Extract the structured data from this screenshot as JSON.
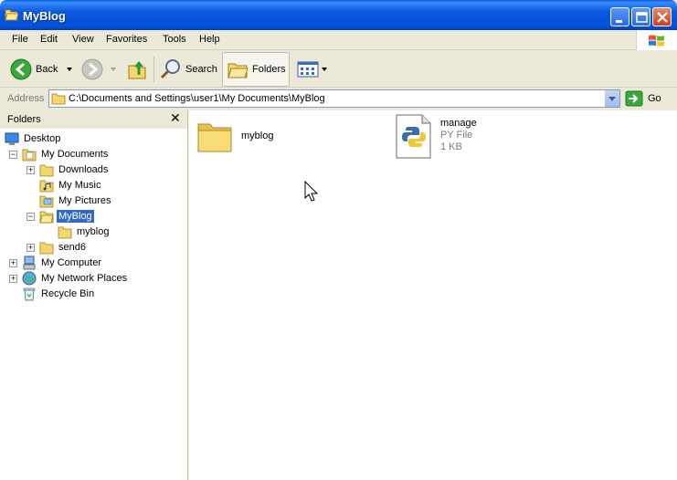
{
  "window": {
    "title": "MyBlog",
    "title_icon": "folder-open-icon"
  },
  "menu": {
    "items": [
      "File",
      "Edit",
      "View",
      "Favorites",
      "Tools",
      "Help"
    ]
  },
  "toolbar": {
    "back_label": "Back",
    "search_label": "Search",
    "folders_label": "Folders"
  },
  "address": {
    "label": "Address",
    "path": "C:\\Documents and Settings\\user1\\My Documents\\MyBlog",
    "go_label": "Go"
  },
  "folders_pane": {
    "title": "Folders",
    "tree": [
      {
        "label": "Desktop",
        "icon": "desktop-icon"
      },
      {
        "label": "My Documents",
        "icon": "my-documents-icon",
        "expanded": true
      },
      {
        "label": "Downloads",
        "icon": "folder-icon"
      },
      {
        "label": "My Music",
        "icon": "my-music-icon"
      },
      {
        "label": "My Pictures",
        "icon": "my-pictures-icon"
      },
      {
        "label": "MyBlog",
        "icon": "folder-open-icon",
        "selected": true,
        "expanded": true
      },
      {
        "label": "myblog",
        "icon": "folder-icon"
      },
      {
        "label": "send6",
        "icon": "folder-icon"
      },
      {
        "label": "My Computer",
        "icon": "my-computer-icon"
      },
      {
        "label": "My Network Places",
        "icon": "network-places-icon"
      },
      {
        "label": "Recycle Bin",
        "icon": "recycle-bin-icon"
      }
    ]
  },
  "files": [
    {
      "name": "myblog",
      "icon": "folder-icon"
    },
    {
      "name": "manage",
      "type": "PY File",
      "size": "1 KB",
      "icon": "python-file-icon"
    }
  ],
  "colors": {
    "title_bar": "#0a58e0",
    "selection": "#316ac5",
    "chrome": "#ece9d8"
  }
}
